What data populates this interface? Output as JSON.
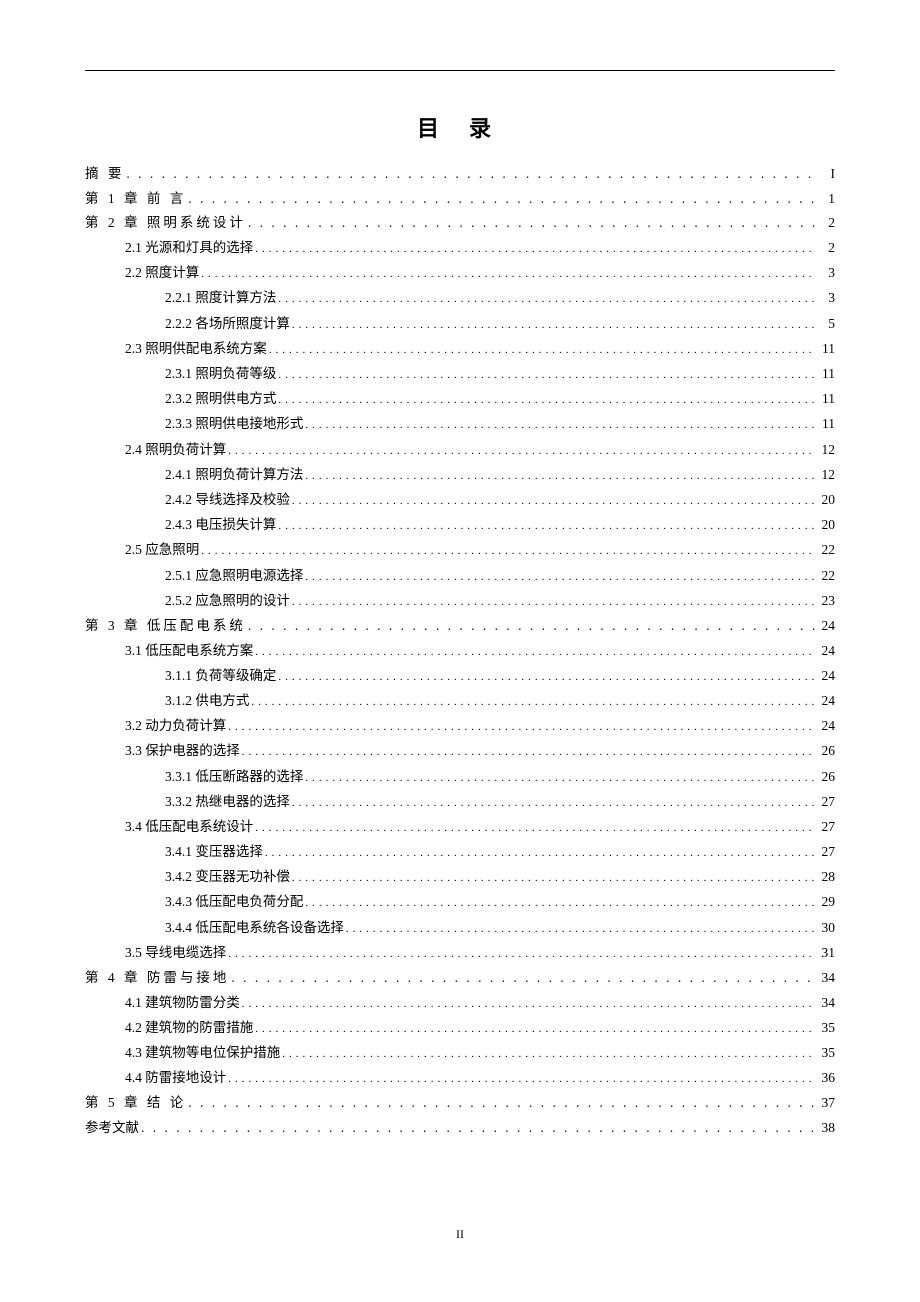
{
  "title": "目 录",
  "page_footer": "II",
  "toc": [
    {
      "level": 1,
      "label": "摘 要",
      "page": "I",
      "spaced": true
    },
    {
      "level": 1,
      "label": "第 1 章 前 言",
      "page": "1",
      "spaced": true
    },
    {
      "level": 1,
      "label": "第 2 章 照明系统设计",
      "page": "2",
      "spaced": true
    },
    {
      "level": 2,
      "label": "2.1 光源和灯具的选择",
      "page": "2"
    },
    {
      "level": 2,
      "label": "2.2 照度计算",
      "page": "3"
    },
    {
      "level": 3,
      "label": "2.2.1 照度计算方法",
      "page": "3"
    },
    {
      "level": 3,
      "label": "2.2.2 各场所照度计算",
      "page": "5"
    },
    {
      "level": 2,
      "label": "2.3 照明供配电系统方案",
      "page": "11"
    },
    {
      "level": 3,
      "label": "2.3.1 照明负荷等级",
      "page": "11"
    },
    {
      "level": 3,
      "label": "2.3.2 照明供电方式",
      "page": "11"
    },
    {
      "level": 3,
      "label": "2.3.3 照明供电接地形式",
      "page": "11"
    },
    {
      "level": 2,
      "label": "2.4 照明负荷计算",
      "page": "12"
    },
    {
      "level": 3,
      "label": "2.4.1 照明负荷计算方法",
      "page": "12"
    },
    {
      "level": 3,
      "label": "2.4.2 导线选择及校验",
      "page": "20"
    },
    {
      "level": 3,
      "label": "2.4.3 电压损失计算",
      "page": "20"
    },
    {
      "level": 2,
      "label": "2.5 应急照明",
      "page": "22"
    },
    {
      "level": 3,
      "label": "2.5.1 应急照明电源选择",
      "page": "22"
    },
    {
      "level": 3,
      "label": "2.5.2 应急照明的设计",
      "page": "23"
    },
    {
      "level": 1,
      "label": "第 3 章 低压配电系统",
      "page": "24",
      "spaced": true
    },
    {
      "level": 2,
      "label": "3.1 低压配电系统方案",
      "page": "24"
    },
    {
      "level": 3,
      "label": "3.1.1 负荷等级确定",
      "page": "24"
    },
    {
      "level": 3,
      "label": "3.1.2 供电方式",
      "page": "24"
    },
    {
      "level": 2,
      "label": "3.2 动力负荷计算",
      "page": "24"
    },
    {
      "level": 2,
      "label": "3.3 保护电器的选择",
      "page": "26"
    },
    {
      "level": 3,
      "label": "3.3.1 低压断路器的选择",
      "page": "26"
    },
    {
      "level": 3,
      "label": "3.3.2 热继电器的选择",
      "page": "27"
    },
    {
      "level": 2,
      "label": "3.4 低压配电系统设计",
      "page": "27"
    },
    {
      "level": 3,
      "label": "3.4.1 变压器选择",
      "page": "27"
    },
    {
      "level": 3,
      "label": "3.4.2 变压器无功补偿",
      "page": "28"
    },
    {
      "level": 3,
      "label": "3.4.3 低压配电负荷分配",
      "page": "29"
    },
    {
      "level": 3,
      "label": "3.4.4 低压配电系统各设备选择",
      "page": "30"
    },
    {
      "level": 2,
      "label": "3.5 导线电缆选择",
      "page": "31"
    },
    {
      "level": 1,
      "label": "第 4 章 防雷与接地",
      "page": "34",
      "spaced": true
    },
    {
      "level": 2,
      "label": "4.1 建筑物防雷分类",
      "page": "34"
    },
    {
      "level": 2,
      "label": "4.2 建筑物的防雷措施",
      "page": "35"
    },
    {
      "level": 2,
      "label": "4.3 建筑物等电位保护措施",
      "page": "35"
    },
    {
      "level": 2,
      "label": "4.4 防雷接地设计",
      "page": "36"
    },
    {
      "level": 1,
      "label": "第 5 章 结 论",
      "page": "37",
      "spaced": true
    },
    {
      "level": 1,
      "label": "参考文献",
      "page": "38"
    }
  ]
}
